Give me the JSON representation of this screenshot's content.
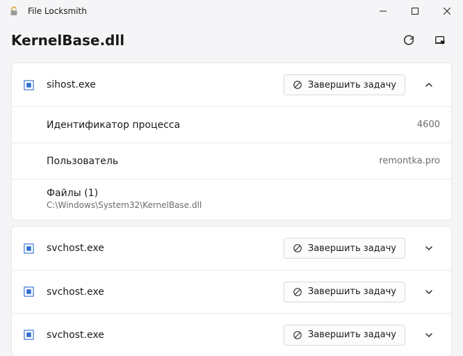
{
  "app": {
    "title": "File Locksmith",
    "icon": "unlock-icon"
  },
  "file": {
    "name": "KernelBase.dll"
  },
  "labels": {
    "end_task": "Завершить задачу",
    "process_id": "Идентификатор процесса",
    "user": "Пользователь",
    "files_prefix": "Файлы"
  },
  "processes": [
    {
      "name": "sihost.exe",
      "expanded": true,
      "pid": "4600",
      "user": "remontka.pro",
      "files_count": 1,
      "files": [
        "C:\\Windows\\System32\\KernelBase.dll"
      ]
    },
    {
      "name": "svchost.exe",
      "expanded": false
    },
    {
      "name": "svchost.exe",
      "expanded": false
    },
    {
      "name": "svchost.exe",
      "expanded": false
    }
  ],
  "colors": {
    "accent_lock_gold": "#dba33a",
    "accent_lock_gray": "#9c9c9c",
    "icon_blue": "#2f6fd0"
  }
}
